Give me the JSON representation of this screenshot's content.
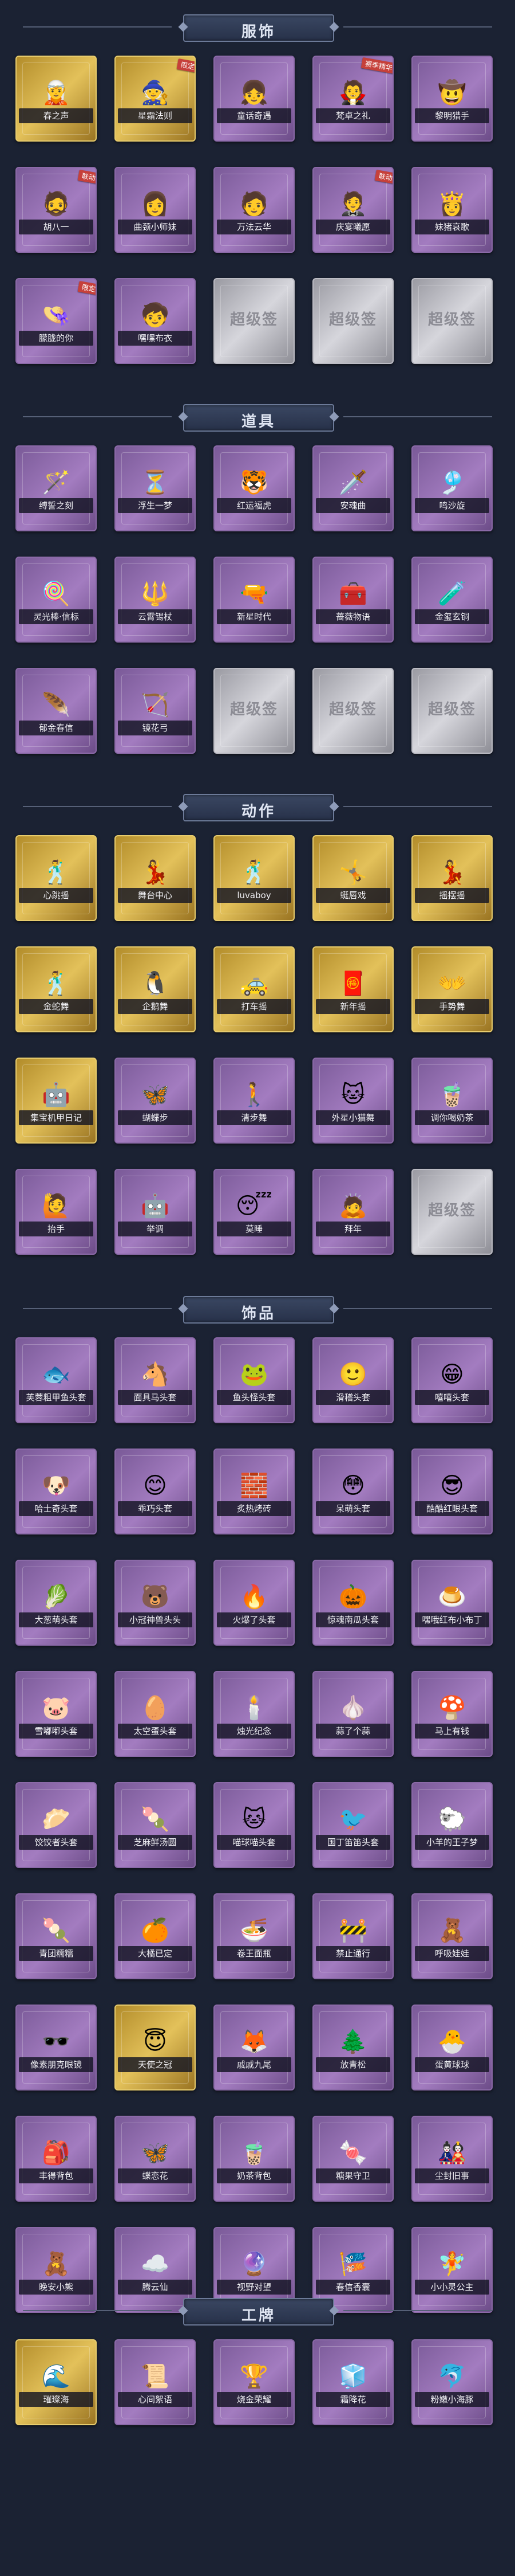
{
  "colors": {
    "background": "#1b2233",
    "normal_card": "#a37cc0",
    "rare_card": "#e3c15a",
    "empty_card": "#d6d6dc"
  },
  "sections": [
    {
      "title": "服饰",
      "items": [
        {
          "name": "春之声",
          "rarity": "gold",
          "icon": "🧝"
        },
        {
          "name": "星霜法则",
          "rarity": "gold",
          "icon": "🧙",
          "badge": "限定"
        },
        {
          "name": "童话奇遇",
          "rarity": "purple",
          "icon": "👧"
        },
        {
          "name": "梵卓之礼",
          "rarity": "purple",
          "icon": "🧛",
          "badge": "赛季精华"
        },
        {
          "name": "黎明猎手",
          "rarity": "purple",
          "icon": "🤠"
        },
        {
          "name": "胡八一",
          "rarity": "purple",
          "icon": "🧔",
          "badge": "联动"
        },
        {
          "name": "曲颈小师妹",
          "rarity": "purple",
          "icon": "👩"
        },
        {
          "name": "万法云华",
          "rarity": "purple",
          "icon": "🧑"
        },
        {
          "name": "庆宴曦愿",
          "rarity": "purple",
          "icon": "🤵",
          "badge": "联动"
        },
        {
          "name": "妹猪哀歌",
          "rarity": "purple",
          "icon": "👸"
        },
        {
          "name": "朦胧的你",
          "rarity": "purple",
          "icon": "👒",
          "badge": "限定"
        },
        {
          "name": "嘿嘿布衣",
          "rarity": "purple",
          "icon": "🧒"
        },
        {
          "name": "",
          "rarity": "blank"
        },
        {
          "name": "",
          "rarity": "blank"
        },
        {
          "name": "",
          "rarity": "blank"
        }
      ]
    },
    {
      "title": "道具",
      "items": [
        {
          "name": "缚誓之刻",
          "rarity": "purple",
          "icon": "🪄"
        },
        {
          "name": "浮生一梦",
          "rarity": "purple",
          "icon": "⏳"
        },
        {
          "name": "红运福虎",
          "rarity": "purple",
          "icon": "🐯"
        },
        {
          "name": "安魂曲",
          "rarity": "purple",
          "icon": "🗡️"
        },
        {
          "name": "鸣沙旋",
          "rarity": "purple",
          "icon": "🎐"
        },
        {
          "name": "灵光棒·信标",
          "rarity": "purple",
          "icon": "🍭"
        },
        {
          "name": "云霄锡杖",
          "rarity": "purple",
          "icon": "🔱"
        },
        {
          "name": "新星时代",
          "rarity": "purple",
          "icon": "🔫"
        },
        {
          "name": "蔷薇物语",
          "rarity": "purple",
          "icon": "🧰"
        },
        {
          "name": "金玺玄铜",
          "rarity": "purple",
          "icon": "🧪"
        },
        {
          "name": "郁金春信",
          "rarity": "purple",
          "icon": "🪶"
        },
        {
          "name": "镜花弓",
          "rarity": "purple",
          "icon": "🏹"
        },
        {
          "name": "",
          "rarity": "blank"
        },
        {
          "name": "",
          "rarity": "blank"
        },
        {
          "name": "",
          "rarity": "blank"
        }
      ]
    },
    {
      "title": "动作",
      "items": [
        {
          "name": "心跳摇",
          "rarity": "gold",
          "icon": "🕺"
        },
        {
          "name": "舞台中心",
          "rarity": "gold",
          "icon": "💃"
        },
        {
          "name": "luvaboy",
          "rarity": "gold",
          "icon": "🕺"
        },
        {
          "name": "蜓唇戏",
          "rarity": "gold",
          "icon": "🤸"
        },
        {
          "name": "摇摆摇",
          "rarity": "gold",
          "icon": "💃"
        },
        {
          "name": "金蛇舞",
          "rarity": "gold",
          "icon": "🕺"
        },
        {
          "name": "企鹅舞",
          "rarity": "gold",
          "icon": "🐧"
        },
        {
          "name": "打车摇",
          "rarity": "gold",
          "icon": "🚕"
        },
        {
          "name": "新年摇",
          "rarity": "gold",
          "icon": "🧧"
        },
        {
          "name": "手势舞",
          "rarity": "gold",
          "icon": "👐"
        },
        {
          "name": "集宝机甲日记",
          "rarity": "gold",
          "icon": "🤖"
        },
        {
          "name": "蝴蝶步",
          "rarity": "purple",
          "icon": "🦋"
        },
        {
          "name": "清步舞",
          "rarity": "purple",
          "icon": "🚶"
        },
        {
          "name": "外星小猫舞",
          "rarity": "purple",
          "icon": "🐱"
        },
        {
          "name": "调你喝奶茶",
          "rarity": "purple",
          "icon": "🧋"
        },
        {
          "name": "抬手",
          "rarity": "purple",
          "icon": "🙋"
        },
        {
          "name": "举调",
          "rarity": "purple",
          "icon": "🤖"
        },
        {
          "name": "莫睡",
          "rarity": "purple",
          "icon": "😴"
        },
        {
          "name": "拜年",
          "rarity": "purple",
          "icon": "🙇"
        },
        {
          "name": "",
          "rarity": "blank"
        }
      ]
    },
    {
      "title": "饰品",
      "items": [
        {
          "name": "芙蓉粗甲鱼头套",
          "rarity": "purple",
          "icon": "🐟"
        },
        {
          "name": "面具马头套",
          "rarity": "purple",
          "icon": "🐴"
        },
        {
          "name": "鱼头怪头套",
          "rarity": "purple",
          "icon": "🐸"
        },
        {
          "name": "滑稽头套",
          "rarity": "purple",
          "icon": "🙂"
        },
        {
          "name": "嘻嘻头套",
          "rarity": "purple",
          "icon": "😁"
        },
        {
          "name": "哈士奇头套",
          "rarity": "purple",
          "icon": "🐶"
        },
        {
          "name": "乖巧头套",
          "rarity": "purple",
          "icon": "😊"
        },
        {
          "name": "炙热烤砖",
          "rarity": "purple",
          "icon": "🧱"
        },
        {
          "name": "呆萌头套",
          "rarity": "purple",
          "icon": "😳"
        },
        {
          "name": "酷酷红眼头套",
          "rarity": "purple",
          "icon": "😎"
        },
        {
          "name": "大葱萌头套",
          "rarity": "purple",
          "icon": "🥬"
        },
        {
          "name": "小冠神兽头头",
          "rarity": "purple",
          "icon": "🐻"
        },
        {
          "name": "火爆了头套",
          "rarity": "purple",
          "icon": "🔥"
        },
        {
          "name": "惊魂南瓜头套",
          "rarity": "purple",
          "icon": "🎃"
        },
        {
          "name": "嘿哦红布小布丁",
          "rarity": "purple",
          "icon": "🍮"
        },
        {
          "name": "雪嘟嘟头套",
          "rarity": "purple",
          "icon": "🐷"
        },
        {
          "name": "太空蛋头套",
          "rarity": "purple",
          "icon": "🥚"
        },
        {
          "name": "烛光纪念",
          "rarity": "purple",
          "icon": "🕯️"
        },
        {
          "name": "蒜了个蒜",
          "rarity": "purple",
          "icon": "🧄"
        },
        {
          "name": "马上有钱",
          "rarity": "purple",
          "icon": "🍄"
        },
        {
          "name": "饺饺者头套",
          "rarity": "purple",
          "icon": "🥟"
        },
        {
          "name": "芝麻鲜汤圆",
          "rarity": "purple",
          "icon": "🍡"
        },
        {
          "name": "喵球喵头套",
          "rarity": "purple",
          "icon": "🐱"
        },
        {
          "name": "国丁笛笛头套",
          "rarity": "purple",
          "icon": "🐦"
        },
        {
          "name": "小羊的王子梦",
          "rarity": "purple",
          "icon": "🐑"
        },
        {
          "name": "青团糯糯",
          "rarity": "purple",
          "icon": "🍡"
        },
        {
          "name": "大橘已定",
          "rarity": "purple",
          "icon": "🍊"
        },
        {
          "name": "卷王面瓶",
          "rarity": "purple",
          "icon": "🍜"
        },
        {
          "name": "禁止通行",
          "rarity": "purple",
          "icon": "🚧"
        },
        {
          "name": "呼吸娃娃",
          "rarity": "purple",
          "icon": "🧸"
        },
        {
          "name": "像素朋克眼镜",
          "rarity": "purple",
          "icon": "🕶️"
        },
        {
          "name": "天使之冠",
          "rarity": "gold",
          "icon": "😇"
        },
        {
          "name": "戚戚九尾",
          "rarity": "purple",
          "icon": "🦊"
        },
        {
          "name": "放青松",
          "rarity": "purple",
          "icon": "🌲"
        },
        {
          "name": "蛋黄球球",
          "rarity": "purple",
          "icon": "🐣"
        },
        {
          "name": "丰得背包",
          "rarity": "purple",
          "icon": "🎒"
        },
        {
          "name": "蝶恋花",
          "rarity": "purple",
          "icon": "🦋"
        },
        {
          "name": "奶茶背包",
          "rarity": "purple",
          "icon": "🧋"
        },
        {
          "name": "糖果守卫",
          "rarity": "purple",
          "icon": "🍬"
        },
        {
          "name": "尘封旧事",
          "rarity": "purple",
          "icon": "🎎"
        },
        {
          "name": "晚安小熊",
          "rarity": "purple",
          "icon": "🧸"
        },
        {
          "name": "腾云仙",
          "rarity": "purple",
          "icon": "☁️"
        },
        {
          "name": "视野对望",
          "rarity": "purple",
          "icon": "🔮"
        },
        {
          "name": "春信香囊",
          "rarity": "purple",
          "icon": "🎏"
        },
        {
          "name": "小小灵公主",
          "rarity": "purple",
          "icon": "🧚"
        }
      ]
    },
    {
      "title": "工牌",
      "items": [
        {
          "name": "璀璨海",
          "rarity": "gold",
          "icon": "🌊"
        },
        {
          "name": "心间絮语",
          "rarity": "purple",
          "icon": "📜"
        },
        {
          "name": "烧金荣耀",
          "rarity": "purple",
          "icon": "🏆"
        },
        {
          "name": "霜降花",
          "rarity": "purple",
          "icon": "🧊"
        },
        {
          "name": "粉嫩小海豚",
          "rarity": "purple",
          "icon": "🐬"
        }
      ]
    }
  ],
  "blank_mark": "超级签"
}
